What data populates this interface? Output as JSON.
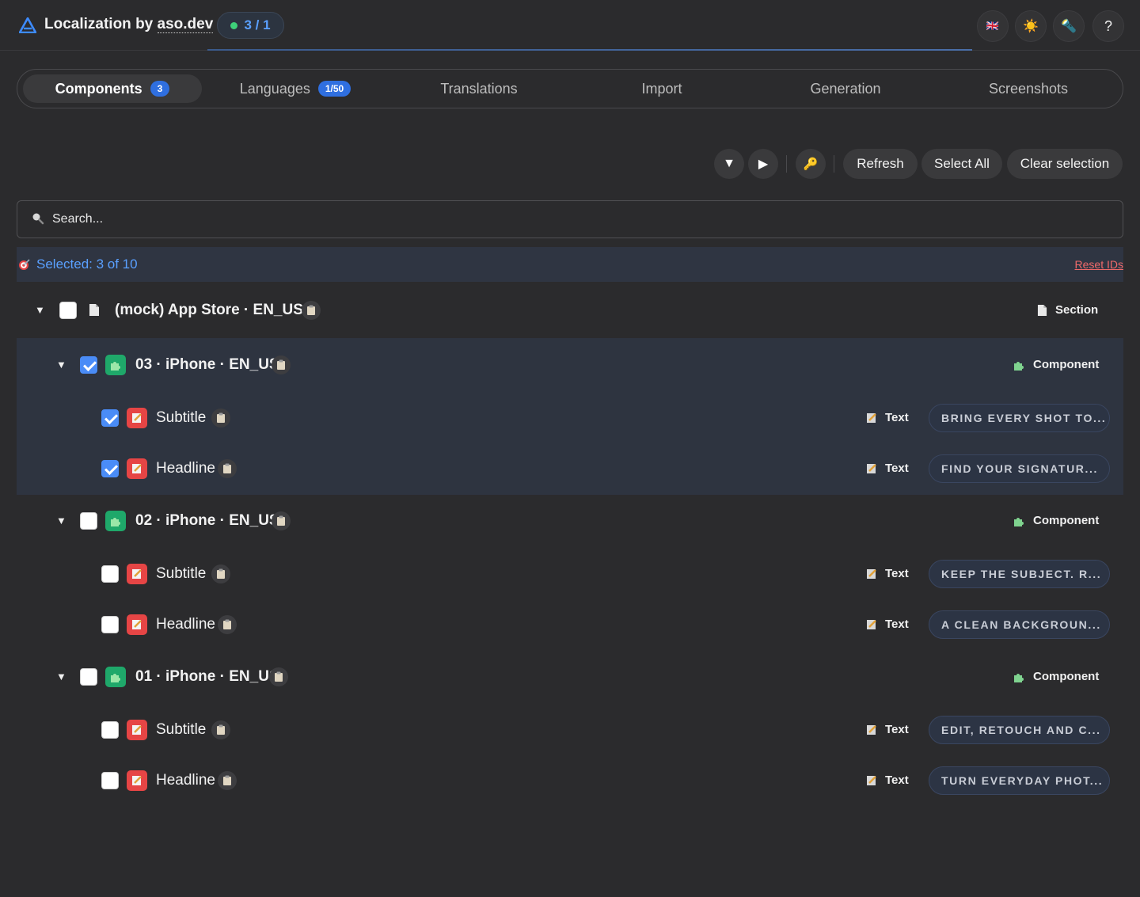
{
  "header": {
    "title_prefix": "Localization by ",
    "title_link": "aso.dev",
    "status": "3 / 1",
    "buttons": {
      "language_flag": "🇬🇧",
      "theme": "☀️",
      "tool": "🔦",
      "help": "?"
    }
  },
  "tabs": [
    {
      "label": "Components",
      "badge": "3",
      "active": true
    },
    {
      "label": "Languages",
      "badge": "1/50",
      "active": false
    },
    {
      "label": "Translations",
      "badge": "",
      "active": false
    },
    {
      "label": "Import",
      "badge": "",
      "active": false
    },
    {
      "label": "Generation",
      "badge": "",
      "active": false
    },
    {
      "label": "Screenshots",
      "badge": "",
      "active": false
    }
  ],
  "toolbar": {
    "collapse_icon": "▼",
    "expand_icon": "▶",
    "key_icon": "🔑",
    "refresh": "Refresh",
    "select_all": "Select All",
    "clear_selection": "Clear selection"
  },
  "search": {
    "placeholder": "Search..."
  },
  "selection": {
    "text": "Selected: 3 of 10",
    "reset": "Reset IDs"
  },
  "tree": {
    "section": {
      "label": "(mock) App Store · EN_US",
      "type": "Section"
    },
    "components": [
      {
        "label": "03 · iPhone · EN_US",
        "type": "Component",
        "checked": true,
        "items": [
          {
            "label": "Subtitle",
            "type": "Text",
            "value": "BRING EVERY SHOT TO...",
            "checked": true
          },
          {
            "label": "Headline",
            "type": "Text",
            "value": "FIND YOUR SIGNATUR...",
            "checked": true
          }
        ]
      },
      {
        "label": "02 · iPhone · EN_US",
        "type": "Component",
        "checked": false,
        "items": [
          {
            "label": "Subtitle",
            "type": "Text",
            "value": "KEEP THE SUBJECT. R...",
            "checked": false
          },
          {
            "label": "Headline",
            "type": "Text",
            "value": "A CLEAN BACKGROUN...",
            "checked": false
          }
        ]
      },
      {
        "label": "01 · iPhone · EN_US",
        "type": "Component",
        "checked": false,
        "items": [
          {
            "label": "Subtitle",
            "type": "Text",
            "value": "EDIT, RETOUCH AND C...",
            "checked": false
          },
          {
            "label": "Headline",
            "type": "Text",
            "value": "TURN EVERYDAY PHOT...",
            "checked": false
          }
        ]
      }
    ]
  },
  "colors": {
    "background": "#2b2b2d",
    "accent_blue": "#4a8cf7",
    "status_blue": "#5aa0ff",
    "reset_red": "#f06a6a",
    "component_green": "#1fa86a",
    "text_red": "#e64545"
  }
}
